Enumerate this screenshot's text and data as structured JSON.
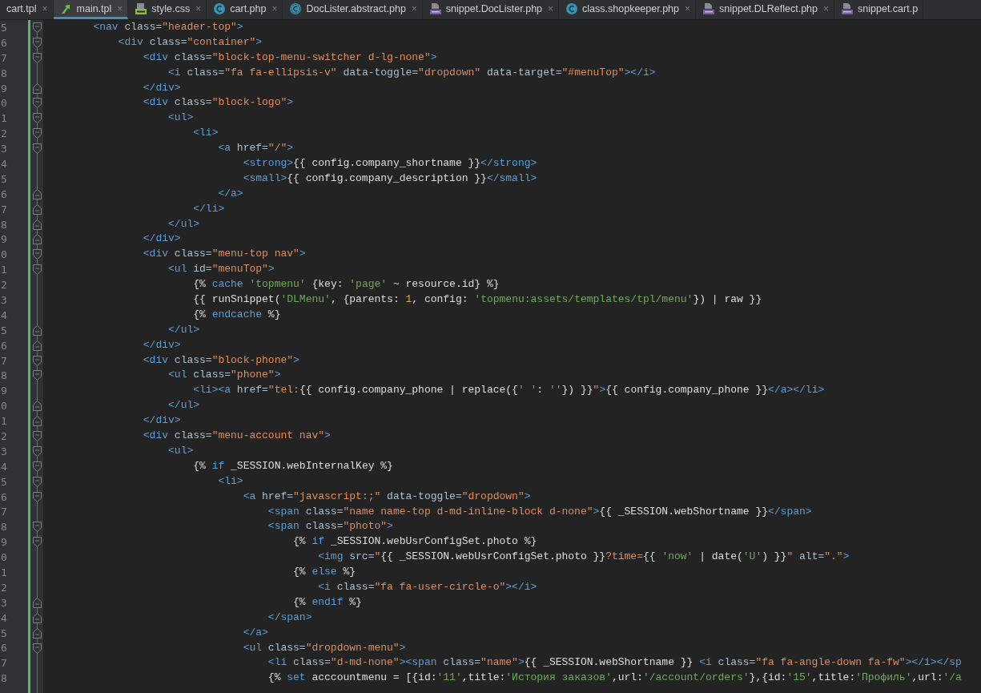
{
  "tabs": [
    {
      "label": "cart.tpl",
      "kind": "plain",
      "selected": false,
      "close": "×"
    },
    {
      "label": "main.tpl",
      "kind": "tpl",
      "selected": true,
      "close": "×"
    },
    {
      "label": "style.css",
      "kind": "css",
      "selected": false,
      "close": "×"
    },
    {
      "label": "cart.php",
      "kind": "class",
      "selected": false,
      "close": "×"
    },
    {
      "label": "DocLister.abstract.php",
      "kind": "abstract",
      "selected": false,
      "close": "×"
    },
    {
      "label": "snippet.DocLister.php",
      "kind": "php",
      "selected": false,
      "close": "×"
    },
    {
      "label": "class.shopkeeper.php",
      "kind": "class",
      "selected": false,
      "close": "×"
    },
    {
      "label": "snippet.DLReflect.php",
      "kind": "php",
      "selected": false,
      "close": "×"
    },
    {
      "label": "snippet.cart.p",
      "kind": "php",
      "selected": false
    }
  ],
  "lines": [
    {
      "number": "5",
      "kind": "fold-start",
      "tokens": [
        {
          "kind": "tag",
          "text": "        <nav"
        },
        {
          "kind": "attr",
          "text": " class="
        },
        {
          "kind": "str",
          "text": "\"header-top\""
        },
        {
          "kind": "tag",
          "text": ">"
        }
      ]
    },
    {
      "number": "6",
      "kind": "fold-start",
      "tokens": [
        {
          "kind": "tag",
          "text": "            <div"
        },
        {
          "kind": "attr",
          "text": " class="
        },
        {
          "kind": "str",
          "text": "\"container\""
        },
        {
          "kind": "tag",
          "text": ">"
        }
      ]
    },
    {
      "number": "7",
      "kind": "fold-start",
      "tokens": [
        {
          "kind": "tag",
          "text": "                <div"
        },
        {
          "kind": "attr",
          "text": " class="
        },
        {
          "kind": "str",
          "text": "\"block-top-menu-switcher d-lg-none\""
        },
        {
          "kind": "tag",
          "text": ">"
        }
      ]
    },
    {
      "number": "8",
      "kind": "plain",
      "tokens": [
        {
          "kind": "tag",
          "text": "                    <i"
        },
        {
          "kind": "attr",
          "text": " class="
        },
        {
          "kind": "str",
          "text": "\"fa fa-ellipsis-v\""
        },
        {
          "kind": "attr",
          "text": " data-toggle="
        },
        {
          "kind": "str",
          "text": "\"dropdown\""
        },
        {
          "kind": "attr",
          "text": " data-target="
        },
        {
          "kind": "str",
          "text": "\"#menuTop\""
        },
        {
          "kind": "tag",
          "text": "></i>"
        }
      ]
    },
    {
      "number": "9",
      "kind": "fold-end",
      "tokens": [
        {
          "kind": "tag",
          "text": "                </div>"
        }
      ]
    },
    {
      "number": "0",
      "kind": "fold-start",
      "tokens": [
        {
          "kind": "tag",
          "text": "                <div"
        },
        {
          "kind": "attr",
          "text": " class="
        },
        {
          "kind": "str",
          "text": "\"block-logo\""
        },
        {
          "kind": "tag",
          "text": ">"
        }
      ]
    },
    {
      "number": "1",
      "kind": "fold-start",
      "tokens": [
        {
          "kind": "tag",
          "text": "                    <ul>"
        }
      ]
    },
    {
      "number": "2",
      "kind": "fold-start",
      "tokens": [
        {
          "kind": "tag",
          "text": "                        <li>"
        }
      ]
    },
    {
      "number": "3",
      "kind": "fold-start",
      "tokens": [
        {
          "kind": "tag",
          "text": "                            <a"
        },
        {
          "kind": "attr",
          "text": " href="
        },
        {
          "kind": "str",
          "text": "\"/\""
        },
        {
          "kind": "tag",
          "text": ">"
        }
      ]
    },
    {
      "number": "4",
      "kind": "plain",
      "tokens": [
        {
          "kind": "tag",
          "text": "                                <strong>"
        },
        {
          "kind": "text",
          "text": "{{ config.company_shortname }}"
        },
        {
          "kind": "tag",
          "text": "</strong>"
        }
      ]
    },
    {
      "number": "5",
      "kind": "plain",
      "tokens": [
        {
          "kind": "tag",
          "text": "                                <small>"
        },
        {
          "kind": "text",
          "text": "{{ config.company_description }}"
        },
        {
          "kind": "tag",
          "text": "</small>"
        }
      ]
    },
    {
      "number": "6",
      "kind": "fold-end",
      "tokens": [
        {
          "kind": "tag",
          "text": "                            </a>"
        }
      ]
    },
    {
      "number": "7",
      "kind": "fold-end",
      "tokens": [
        {
          "kind": "tag",
          "text": "                        </li>"
        }
      ]
    },
    {
      "number": "8",
      "kind": "fold-end",
      "tokens": [
        {
          "kind": "tag",
          "text": "                    </ul>"
        }
      ]
    },
    {
      "number": "9",
      "kind": "fold-end",
      "tokens": [
        {
          "kind": "tag",
          "text": "                </div>"
        }
      ]
    },
    {
      "number": "0",
      "kind": "fold-start",
      "tokens": [
        {
          "kind": "tag",
          "text": "                <div"
        },
        {
          "kind": "attr",
          "text": " class="
        },
        {
          "kind": "str",
          "text": "\"menu-top nav\""
        },
        {
          "kind": "tag",
          "text": ">"
        }
      ]
    },
    {
      "number": "1",
      "kind": "fold-start",
      "tokens": [
        {
          "kind": "tag",
          "text": "                    <ul"
        },
        {
          "kind": "attr",
          "text": " id="
        },
        {
          "kind": "str",
          "text": "\"menuTop\""
        },
        {
          "kind": "tag",
          "text": ">"
        }
      ]
    },
    {
      "number": "2",
      "kind": "plain",
      "tokens": [
        {
          "kind": "text",
          "text": "                        {% "
        },
        {
          "kind": "kw",
          "text": "cache"
        },
        {
          "kind": "twstr",
          "text": " 'topmenu'"
        },
        {
          "kind": "text",
          "text": " {key: "
        },
        {
          "kind": "twstr",
          "text": "'page'"
        },
        {
          "kind": "text",
          "text": " ~ resource.id} %}"
        }
      ]
    },
    {
      "number": "3",
      "kind": "plain",
      "tokens": [
        {
          "kind": "text",
          "text": "                        {{ runSnippet("
        },
        {
          "kind": "twstr",
          "text": "'DLMenu'"
        },
        {
          "kind": "text",
          "text": ", {parents: "
        },
        {
          "kind": "num",
          "text": "1"
        },
        {
          "kind": "text",
          "text": ", config: "
        },
        {
          "kind": "twstr",
          "text": "'topmenu:assets/templates/tpl/menu'"
        },
        {
          "kind": "text",
          "text": "}) | raw }}"
        }
      ]
    },
    {
      "number": "4",
      "kind": "plain",
      "tokens": [
        {
          "kind": "text",
          "text": "                        {% "
        },
        {
          "kind": "kw",
          "text": "endcache"
        },
        {
          "kind": "text",
          "text": " %}"
        }
      ]
    },
    {
      "number": "5",
      "kind": "fold-end",
      "tokens": [
        {
          "kind": "tag",
          "text": "                    </ul>"
        }
      ]
    },
    {
      "number": "6",
      "kind": "fold-end",
      "tokens": [
        {
          "kind": "tag",
          "text": "                </div>"
        }
      ]
    },
    {
      "number": "7",
      "kind": "fold-start",
      "tokens": [
        {
          "kind": "tag",
          "text": "                <div"
        },
        {
          "kind": "attr",
          "text": " class="
        },
        {
          "kind": "str",
          "text": "\"block-phone\""
        },
        {
          "kind": "tag",
          "text": ">"
        }
      ]
    },
    {
      "number": "8",
      "kind": "fold-start",
      "tokens": [
        {
          "kind": "tag",
          "text": "                    <ul"
        },
        {
          "kind": "attr",
          "text": " class="
        },
        {
          "kind": "str",
          "text": "\"phone\""
        },
        {
          "kind": "tag",
          "text": ">"
        }
      ]
    },
    {
      "number": "9",
      "kind": "plain",
      "tokens": [
        {
          "kind": "tag",
          "text": "                        <li><a"
        },
        {
          "kind": "attr",
          "text": " href="
        },
        {
          "kind": "str",
          "text": "\"tel:"
        },
        {
          "kind": "text",
          "text": "{{ config.company_phone | replace({"
        },
        {
          "kind": "twstr",
          "text": "' '"
        },
        {
          "kind": "text",
          "text": ": "
        },
        {
          "kind": "twstr",
          "text": "''"
        },
        {
          "kind": "text",
          "text": "}) }}"
        },
        {
          "kind": "str",
          "text": "\""
        },
        {
          "kind": "tag",
          "text": ">"
        },
        {
          "kind": "text",
          "text": "{{ config.company_phone }}"
        },
        {
          "kind": "tag",
          "text": "</a></li>"
        }
      ]
    },
    {
      "number": "0",
      "kind": "fold-end",
      "tokens": [
        {
          "kind": "tag",
          "text": "                    </ul>"
        }
      ]
    },
    {
      "number": "1",
      "kind": "fold-end",
      "tokens": [
        {
          "kind": "tag",
          "text": "                </div>"
        }
      ]
    },
    {
      "number": "2",
      "kind": "fold-start",
      "tokens": [
        {
          "kind": "tag",
          "text": "                <div"
        },
        {
          "kind": "attr",
          "text": " class="
        },
        {
          "kind": "str",
          "text": "\"menu-account nav\""
        },
        {
          "kind": "tag",
          "text": ">"
        }
      ]
    },
    {
      "number": "3",
      "kind": "fold-start",
      "tokens": [
        {
          "kind": "tag",
          "text": "                    <ul>"
        }
      ]
    },
    {
      "number": "4",
      "kind": "fold-start",
      "tokens": [
        {
          "kind": "text",
          "text": "                        {% "
        },
        {
          "kind": "kw",
          "text": "if"
        },
        {
          "kind": "text",
          "text": " _SESSION.webInternalKey %}"
        }
      ]
    },
    {
      "number": "5",
      "kind": "fold-start",
      "tokens": [
        {
          "kind": "tag",
          "text": "                            <li>"
        }
      ]
    },
    {
      "number": "6",
      "kind": "fold-start",
      "tokens": [
        {
          "kind": "tag",
          "text": "                                <a"
        },
        {
          "kind": "attr",
          "text": " href="
        },
        {
          "kind": "str",
          "text": "\"javascript:;\""
        },
        {
          "kind": "attr",
          "text": " data-toggle="
        },
        {
          "kind": "str",
          "text": "\"dropdown\""
        },
        {
          "kind": "tag",
          "text": ">"
        }
      ]
    },
    {
      "number": "7",
      "kind": "plain",
      "tokens": [
        {
          "kind": "tag",
          "text": "                                    <span"
        },
        {
          "kind": "attr",
          "text": " class="
        },
        {
          "kind": "str",
          "text": "\"name name-top d-md-inline-block d-none\""
        },
        {
          "kind": "tag",
          "text": ">"
        },
        {
          "kind": "text",
          "text": "{{ _SESSION.webShortname }}"
        },
        {
          "kind": "tag",
          "text": "</span>"
        }
      ]
    },
    {
      "number": "8",
      "kind": "fold-start",
      "tokens": [
        {
          "kind": "tag",
          "text": "                                    <span"
        },
        {
          "kind": "attr",
          "text": " class="
        },
        {
          "kind": "str",
          "text": "\"photo\""
        },
        {
          "kind": "tag",
          "text": ">"
        }
      ]
    },
    {
      "number": "9",
      "kind": "fold-start",
      "tokens": [
        {
          "kind": "text",
          "text": "                                        {% "
        },
        {
          "kind": "kw",
          "text": "if"
        },
        {
          "kind": "text",
          "text": " _SESSION.webUsrConfigSet.photo %}"
        }
      ]
    },
    {
      "number": "0",
      "kind": "plain",
      "tokens": [
        {
          "kind": "tag",
          "text": "                                            <img"
        },
        {
          "kind": "attr",
          "text": " src="
        },
        {
          "kind": "str",
          "text": "\""
        },
        {
          "kind": "text",
          "text": "{{ _SESSION.webUsrConfigSet.photo }}"
        },
        {
          "kind": "str",
          "text": "?time="
        },
        {
          "kind": "text",
          "text": "{{ "
        },
        {
          "kind": "twstr",
          "text": "'now'"
        },
        {
          "kind": "text",
          "text": " | date("
        },
        {
          "kind": "twstr",
          "text": "'U'"
        },
        {
          "kind": "text",
          "text": ") }}"
        },
        {
          "kind": "str",
          "text": "\""
        },
        {
          "kind": "attr",
          "text": " alt="
        },
        {
          "kind": "str",
          "text": "\".\""
        },
        {
          "kind": "tag",
          "text": ">"
        }
      ]
    },
    {
      "number": "1",
      "kind": "plain",
      "tokens": [
        {
          "kind": "text",
          "text": "                                        {% "
        },
        {
          "kind": "kw",
          "text": "else"
        },
        {
          "kind": "text",
          "text": " %}"
        }
      ]
    },
    {
      "number": "2",
      "kind": "plain",
      "tokens": [
        {
          "kind": "tag",
          "text": "                                            <i"
        },
        {
          "kind": "attr",
          "text": " class="
        },
        {
          "kind": "str",
          "text": "\"fa fa-user-circle-o\""
        },
        {
          "kind": "tag",
          "text": "></i>"
        }
      ]
    },
    {
      "number": "3",
      "kind": "fold-end",
      "tokens": [
        {
          "kind": "text",
          "text": "                                        {% "
        },
        {
          "kind": "kw",
          "text": "endif"
        },
        {
          "kind": "text",
          "text": " %}"
        }
      ]
    },
    {
      "number": "4",
      "kind": "fold-end",
      "tokens": [
        {
          "kind": "tag",
          "text": "                                    </span>"
        }
      ]
    },
    {
      "number": "5",
      "kind": "fold-end",
      "tokens": [
        {
          "kind": "tag",
          "text": "                                </a>"
        }
      ]
    },
    {
      "number": "6",
      "kind": "fold-start",
      "tokens": [
        {
          "kind": "tag",
          "text": "                                <ul"
        },
        {
          "kind": "attr",
          "text": " class="
        },
        {
          "kind": "str",
          "text": "\"dropdown-menu\""
        },
        {
          "kind": "tag",
          "text": ">"
        }
      ]
    },
    {
      "number": "7",
      "kind": "plain",
      "tokens": [
        {
          "kind": "tag",
          "text": "                                    <li"
        },
        {
          "kind": "attr",
          "text": " class="
        },
        {
          "kind": "str",
          "text": "\"d-md-none\""
        },
        {
          "kind": "tag",
          "text": "><span"
        },
        {
          "kind": "attr",
          "text": " class="
        },
        {
          "kind": "str",
          "text": "\"name\""
        },
        {
          "kind": "tag",
          "text": ">"
        },
        {
          "kind": "text",
          "text": "{{ _SESSION.webShortname }} "
        },
        {
          "kind": "tag",
          "text": "<i"
        },
        {
          "kind": "attr",
          "text": " class="
        },
        {
          "kind": "str",
          "text": "\"fa fa-angle-down fa-fw\""
        },
        {
          "kind": "tag",
          "text": "></i></sp"
        }
      ]
    },
    {
      "number": "8",
      "kind": "plain",
      "tokens": [
        {
          "kind": "text",
          "text": "                                    {% "
        },
        {
          "kind": "kw",
          "text": "set"
        },
        {
          "kind": "text",
          "text": " acccountmenu = [{id:"
        },
        {
          "kind": "twstr",
          "text": "'11'"
        },
        {
          "kind": "text",
          "text": ",title:"
        },
        {
          "kind": "twstr",
          "text": "'История заказов'"
        },
        {
          "kind": "text",
          "text": ",url:"
        },
        {
          "kind": "twstr",
          "text": "'/account/orders'"
        },
        {
          "kind": "text",
          "text": "},{id:"
        },
        {
          "kind": "twstr",
          "text": "'15'"
        },
        {
          "kind": "text",
          "text": ",title:"
        },
        {
          "kind": "twstr",
          "text": "'Профиль'"
        },
        {
          "kind": "text",
          "text": ",url:"
        },
        {
          "kind": "twstr",
          "text": "'/a"
        }
      ]
    }
  ]
}
